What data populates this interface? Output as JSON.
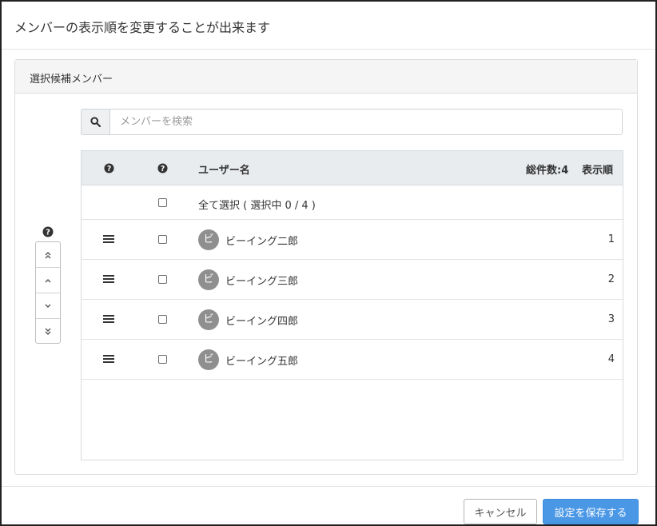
{
  "dialog": {
    "title": "メンバーの表示順を変更することが出来ます"
  },
  "panel": {
    "heading": "選択候補メンバー"
  },
  "search": {
    "placeholder": "メンバーを検索",
    "value": ""
  },
  "table": {
    "header": {
      "col_help1_icon": "question-circle-icon",
      "col_help2_icon": "question-circle-icon",
      "username": "ユーザー名",
      "total": "総件数:4",
      "order": "表示順"
    },
    "select_all_label": "全て選択 ( 選択中 0 / 4 )",
    "rows": [
      {
        "avatar": "ビ",
        "name": "ビーイング二郎",
        "order": "1",
        "checked": false
      },
      {
        "avatar": "ビ",
        "name": "ビーイング三郎",
        "order": "2",
        "checked": false
      },
      {
        "avatar": "ビ",
        "name": "ビーイング四郎",
        "order": "3",
        "checked": false
      },
      {
        "avatar": "ビ",
        "name": "ビーイング五郎",
        "order": "4",
        "checked": false
      }
    ]
  },
  "order_controls": {
    "help_icon": "question-circle-icon",
    "buttons": [
      "move-to-top-icon",
      "move-up-icon",
      "move-down-icon",
      "move-to-bottom-icon"
    ]
  },
  "footer": {
    "cancel_label": "キャンセル",
    "save_label": "設定を保存する"
  },
  "colors": {
    "primary": "#4a97e6",
    "avatar": "#8f8f8f",
    "table_header": "#e9ecef",
    "panel_heading": "#f5f5f5"
  }
}
